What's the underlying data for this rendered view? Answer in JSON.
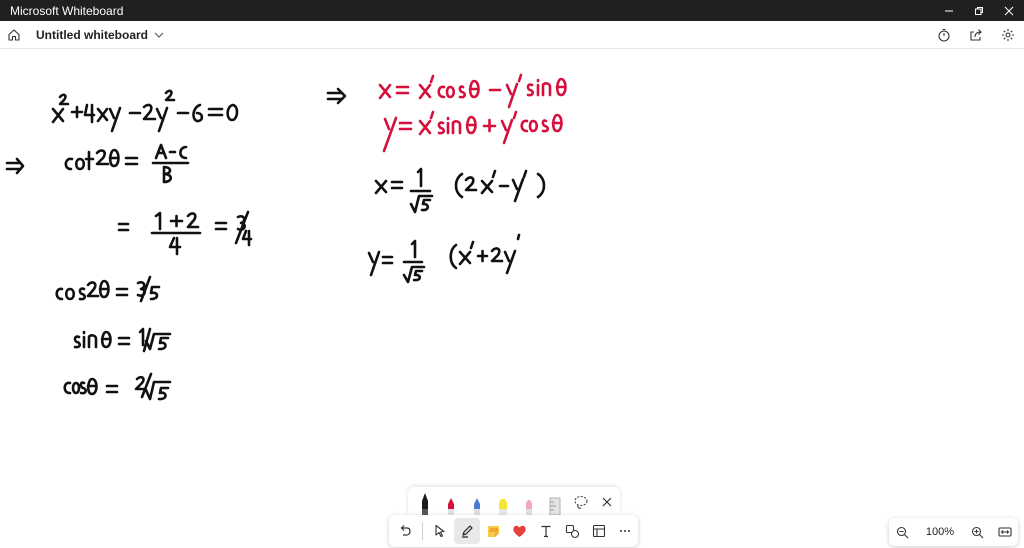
{
  "app": {
    "title": "Microsoft Whiteboard"
  },
  "header": {
    "board_title": "Untitled whiteboard"
  },
  "icons": {
    "home": "home-icon",
    "chevron": "chevron-down-icon",
    "timer": "timer-icon",
    "share": "share-icon",
    "settings": "gear-icon",
    "undo": "undo-icon",
    "select": "pointer-icon",
    "pen": "pen-icon",
    "sticky": "sticky-note-icon",
    "reactions": "heart-icon",
    "text": "text-icon",
    "shapes": "shapes-icon",
    "templates": "template-icon",
    "close": "close-icon",
    "zoom_out": "zoom-out-icon",
    "zoom_in": "zoom-in-icon",
    "fit": "fit-screen-icon"
  },
  "pens": [
    {
      "name": "black-pen",
      "color": "#1a1a1a"
    },
    {
      "name": "red-pen",
      "color": "#d6103c"
    },
    {
      "name": "blue-pen",
      "color": "#4a7bd0"
    },
    {
      "name": "yellow-highlighter",
      "color": "#f5e52d"
    },
    {
      "name": "pink-pen",
      "color": "#e85a8a"
    },
    {
      "name": "ruler",
      "color": "#c8c8c8"
    }
  ],
  "zoom": {
    "level": "100%"
  },
  "colors": {
    "ink_black": "#111111",
    "ink_red": "#d6103c",
    "titlebar": "#202020"
  }
}
